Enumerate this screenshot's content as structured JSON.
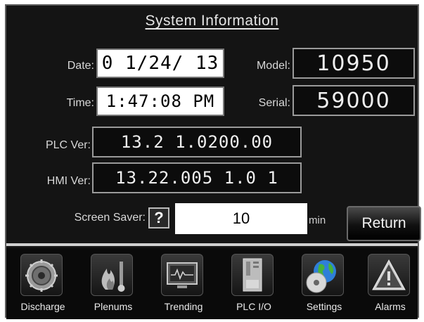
{
  "page": {
    "title": "System Information"
  },
  "fields": {
    "date_label": "Date:",
    "date_value": "0 1/24/ 13",
    "time_label": "Time:",
    "time_value": "1:47:08 PM",
    "model_label": "Model:",
    "model_value": "10950",
    "serial_label": "Serial:",
    "serial_value": "59000",
    "plc_ver_label": "PLC Ver:",
    "plc_ver_value": "13.2 1.0200.00",
    "hmi_ver_label": "HMI Ver:",
    "hmi_ver_value": "13.22.005 1.0 1",
    "screen_saver_label": "Screen Saver:",
    "screen_saver_value": "10",
    "screen_saver_unit": "min"
  },
  "buttons": {
    "help": "?",
    "return": "Return"
  },
  "nav": {
    "items": [
      {
        "label": "Discharge",
        "icon": "gear-disc-icon"
      },
      {
        "label": "Plenums",
        "icon": "flame-icon"
      },
      {
        "label": "Trending",
        "icon": "chart-screen-icon"
      },
      {
        "label": "PLC I/O",
        "icon": "plc-module-icon"
      },
      {
        "label": "Settings",
        "icon": "globe-cd-icon"
      },
      {
        "label": "Alarms",
        "icon": "warning-triangle-icon"
      }
    ]
  },
  "colors": {
    "panel_bg": "#141414",
    "text": "#d8d8d8",
    "field_white": "#ffffff",
    "field_dark": "#0c0c0c",
    "settings_blue": "#2f7fd8",
    "settings_green": "#47b23a"
  }
}
